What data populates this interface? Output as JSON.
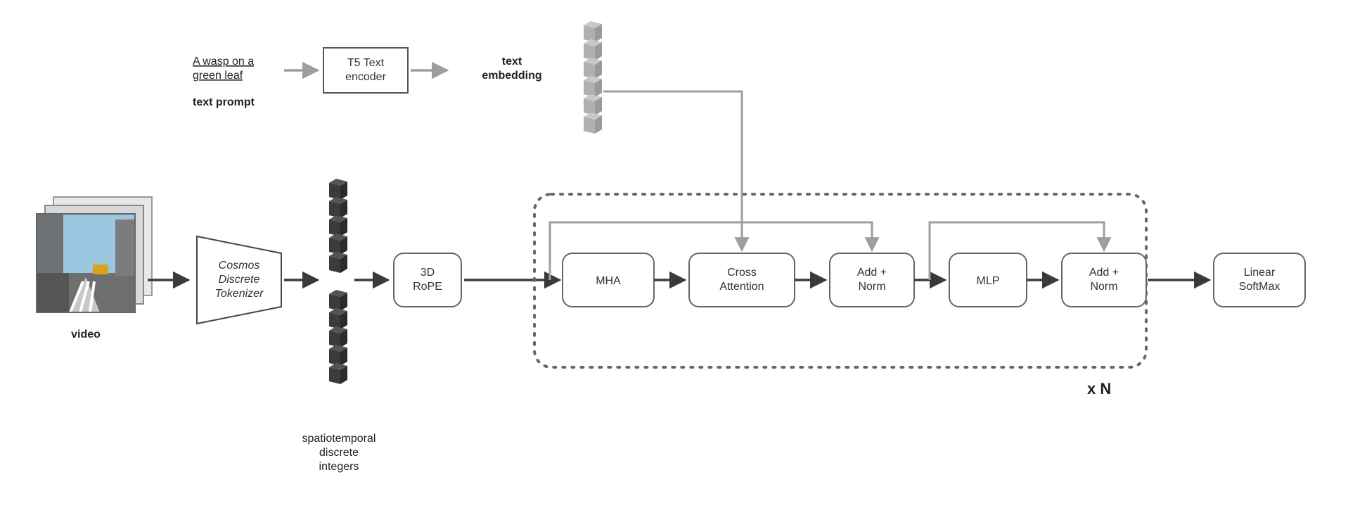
{
  "video_label": "video",
  "tokenizer": {
    "l1": "Cosmos",
    "l2": "Discrete",
    "l3": "Tokenizer"
  },
  "tokens_label": {
    "l1": "spatiotemporal",
    "l2": "discrete",
    "l3": "integers"
  },
  "rope": {
    "l1": "3D",
    "l2": "RoPE"
  },
  "prompt": {
    "l1": "A wasp on a",
    "l2": "green leaf",
    "caption": "text prompt"
  },
  "encoder": {
    "l1": "T5 Text",
    "l2": "encoder"
  },
  "embed_label": {
    "l1": "text",
    "l2": "embedding"
  },
  "blocks": {
    "mha": "MHA",
    "cross": {
      "l1": "Cross",
      "l2": "Attention"
    },
    "addnorm1": {
      "l1": "Add +",
      "l2": "Norm"
    },
    "mlp": "MLP",
    "addnorm2": {
      "l1": "Add +",
      "l2": "Norm"
    },
    "out": {
      "l1": "Linear",
      "l2": "SoftMax"
    }
  },
  "repeat": "x N"
}
